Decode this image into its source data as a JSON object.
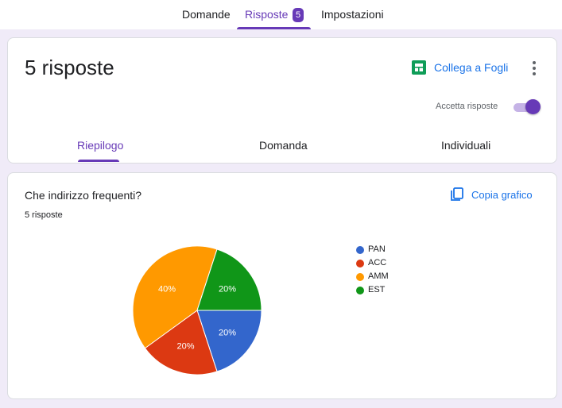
{
  "top_tabs": [
    {
      "label": "Domande"
    },
    {
      "label": "Risposte",
      "badge": "5"
    },
    {
      "label": "Impostazioni"
    }
  ],
  "header": {
    "title": "5 risposte",
    "sheets_link": "Collega a Fogli",
    "accept_label": "Accetta risposte",
    "accept_on": true
  },
  "sub_tabs": [
    {
      "label": "Riepilogo"
    },
    {
      "label": "Domanda"
    },
    {
      "label": "Individuali"
    }
  ],
  "question": {
    "title": "Che indirizzo frequenti?",
    "count": "5 risposte",
    "copy_label": "Copia grafico"
  },
  "colors": {
    "accent": "#673ab7",
    "link": "#1a73e8"
  },
  "chart_data": {
    "type": "pie",
    "categories": [
      "PAN",
      "ACC",
      "AMM",
      "EST"
    ],
    "values": [
      1,
      1,
      2,
      1
    ],
    "percent_labels": [
      "20%",
      "20%",
      "40%",
      "20%"
    ],
    "colors": [
      "#3366cc",
      "#dc3912",
      "#ff9900",
      "#109618"
    ],
    "legend": "right"
  }
}
